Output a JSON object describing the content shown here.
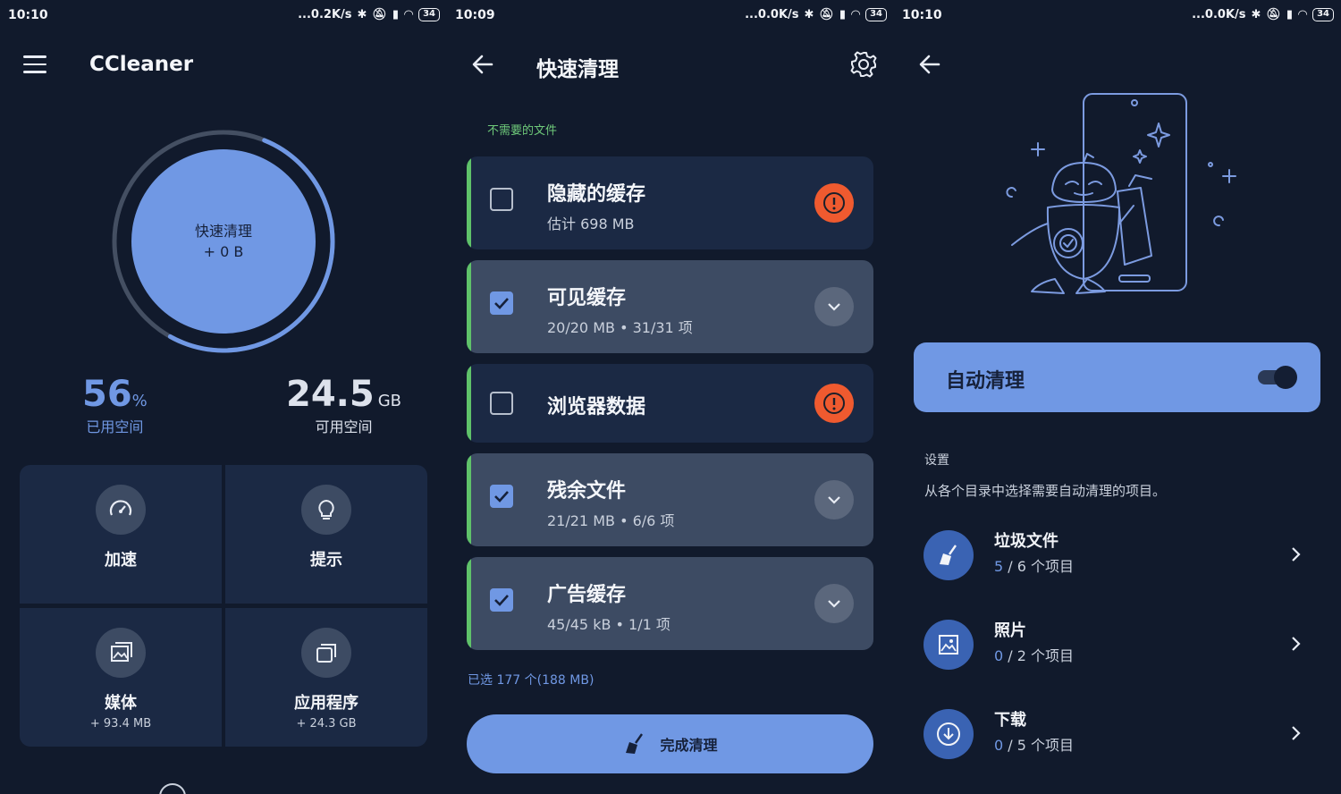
{
  "screens": [
    {
      "status": {
        "time": "10:10",
        "net": "...0.2K/s",
        "battery": "34"
      },
      "app_title": "CCleaner",
      "ring": {
        "label": "快速清理",
        "value": "+ 0 B",
        "progress": 0.52
      },
      "stats": [
        {
          "num": "56",
          "unit": "%",
          "label": "已用空间"
        },
        {
          "num": "24.5",
          "unit": "GB",
          "label": "可用空间"
        }
      ],
      "tiles": [
        {
          "label": "加速",
          "sub": "",
          "icon": "speedometer-icon"
        },
        {
          "label": "提示",
          "sub": "",
          "icon": "lightbulb-icon"
        },
        {
          "label": "媒体",
          "sub": "+ 93.4 MB",
          "icon": "image-icon"
        },
        {
          "label": "应用程序",
          "sub": "+ 24.3 GB",
          "icon": "apps-icon"
        }
      ]
    },
    {
      "status": {
        "time": "10:09",
        "net": "...0.0K/s",
        "battery": "34"
      },
      "title": "快速清理",
      "section_label": "不需要的文件",
      "items": [
        {
          "title": "隐藏的缓存",
          "sub": "估计 698 MB",
          "checked": false,
          "action": "warning"
        },
        {
          "title": "可见缓存",
          "sub": "20/20 MB • 31/31 项",
          "checked": true,
          "action": "expand"
        },
        {
          "title": "浏览器数据",
          "sub": "",
          "checked": false,
          "action": "warning"
        },
        {
          "title": "残余文件",
          "sub": "21/21 MB • 6/6 项",
          "checked": true,
          "action": "expand"
        },
        {
          "title": "广告缓存",
          "sub": "45/45 kB • 1/1 项",
          "checked": true,
          "action": "expand"
        }
      ],
      "selected_info": "已选 177 个(188 MB)",
      "finish_label": "完成清理"
    },
    {
      "status": {
        "time": "10:10",
        "net": "...0.0K/s",
        "battery": "34"
      },
      "auto_clean_label": "自动清理",
      "auto_clean_on": true,
      "settings_heading": "设置",
      "settings_desc": "从各个目录中选择需要自动清理的项目。",
      "rows": [
        {
          "title": "垃圾文件",
          "count": "5",
          "rest": " / 6 个项目",
          "icon": "broom-icon"
        },
        {
          "title": "照片",
          "count": "0",
          "rest": " / 2 个项目",
          "icon": "photo-icon"
        },
        {
          "title": "下载",
          "count": "0",
          "rest": " / 5 个项目",
          "icon": "download-icon"
        }
      ]
    }
  ],
  "colors": {
    "background": "#111a2c",
    "accent": "#7098e4",
    "card_dark": "#1b2944",
    "card_light": "#3d4b63",
    "green_accent": "#5fc26a",
    "warning": "#ef5a2f"
  }
}
